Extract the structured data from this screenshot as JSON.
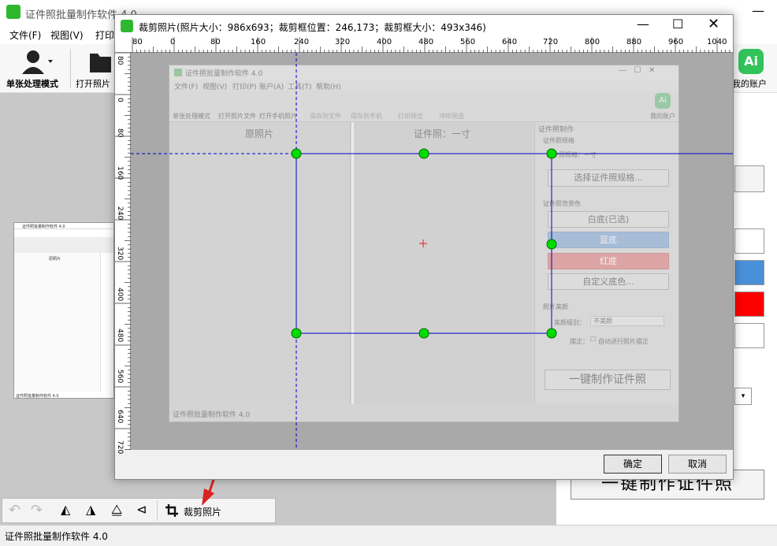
{
  "app": {
    "title": "证件照批量制作软件 4.0",
    "menu": [
      "文件(F)",
      "视图(V)",
      "打印"
    ],
    "toolbar": {
      "single_mode": "单张处理模式",
      "open_photo": "打开照片",
      "my_account": "我的账户",
      "ai_badge": "Ai"
    },
    "bottom_tools": {
      "crop_label": "裁剪照片"
    },
    "right_panel": {
      "one_key_button": "一键制作证件照"
    },
    "status": "证件照批量制作软件 4.0",
    "colors": {
      "blue_swatch": "#4a90d9",
      "red_swatch": "#ff0000",
      "white_swatch": "#ffffff"
    }
  },
  "dialog": {
    "title": "裁剪照片(照片大小：986x693；裁剪框位置：246,173；裁剪框大小：493x346)",
    "ruler_top_labels": [
      "80",
      "0",
      "80",
      "160",
      "240",
      "320",
      "400",
      "480",
      "560",
      "640",
      "720",
      "800",
      "880",
      "960",
      "1040"
    ],
    "ruler_left_labels": [
      "80",
      "0",
      "80",
      "160",
      "240",
      "320",
      "400",
      "480",
      "560",
      "640",
      "720"
    ],
    "ok_button": "确定",
    "cancel_button": "取消",
    "crop_box_color": "#0000cc",
    "handle_color": "#00dd00"
  },
  "inner": {
    "title": "证件照批量制作软件 4.0",
    "menu": [
      "文件(F)",
      "视图(V)",
      "打印(P)",
      "账户(A)",
      "工具(T)",
      "帮助(H)"
    ],
    "tools": [
      "单张处理模式",
      "打开照片文件",
      "打开手机照片",
      "保存到文件",
      "保存到手机",
      "打印预览",
      "冲印预选"
    ],
    "my_account": "我的账户",
    "ai_badge": "Ai",
    "original_label": "原照片",
    "idphoto_label": "证件照：一寸",
    "panel_title": "证件照制作",
    "spec_header": "证件照规格",
    "spec_current": "证件照规格：一寸",
    "select_spec": "选择证件照规格...",
    "bg_header": "证件照背景色",
    "white_bg": "白底(已选)",
    "blue_bg": "蓝底",
    "red_bg": "红底",
    "custom_bg": "自定义底色...",
    "beauty_header": "照片美颜",
    "beauty_level_label": "美颜级别：",
    "beauty_level_value": "不美颜",
    "skew_label": "摆正：",
    "skew_checkbox": "自动进行照片摆正",
    "one_key": "一键制作证件照",
    "status": "证件照批量制作软件 4.0"
  },
  "mini": {
    "title": "证件照批量制作软件 4.0",
    "original_label": "原照片",
    "status": "证件照批量制作软件 4.0"
  }
}
